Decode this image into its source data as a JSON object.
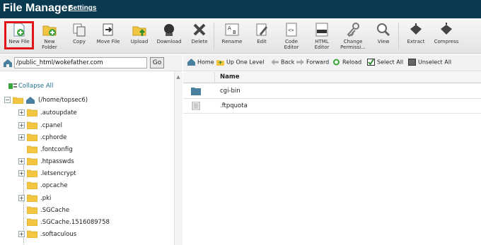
{
  "header": {
    "title": "File Manager",
    "settings_label": "Settings"
  },
  "toolbar": {
    "buttons": [
      {
        "label": "New File",
        "icon": "new-file-icon",
        "highlighted": true
      },
      {
        "label": "New\nFolder",
        "icon": "new-folder-icon"
      },
      {
        "label": "Copy",
        "icon": "copy-icon"
      },
      {
        "label": "Move File",
        "icon": "move-file-icon"
      },
      {
        "label": "Upload",
        "icon": "upload-icon"
      },
      {
        "label": "Download",
        "icon": "download-icon"
      },
      {
        "label": "Delete",
        "icon": "delete-icon"
      },
      {
        "label": "Rename",
        "icon": "rename-icon"
      },
      {
        "label": "Edit",
        "icon": "edit-icon"
      },
      {
        "label": "Code\nEditor",
        "icon": "code-editor-icon"
      },
      {
        "label": "HTML\nEditor",
        "icon": "html-editor-icon"
      },
      {
        "label": "Change\nPermissi...",
        "icon": "permissions-icon"
      },
      {
        "label": "View",
        "icon": "view-icon"
      },
      {
        "label": "Extract",
        "icon": "extract-icon"
      },
      {
        "label": "Compress",
        "icon": "compress-icon"
      }
    ],
    "highlight_color": "#e2141a"
  },
  "path_bar": {
    "path": "/public_html/wokefather.com",
    "go_label": "Go"
  },
  "tree": {
    "collapse_label": "Collapse All",
    "root": "(/home/topsec6)",
    "items": [
      {
        "label": ".autoupdate",
        "expandable": true
      },
      {
        "label": ".cpanel",
        "expandable": true
      },
      {
        "label": ".cphorde",
        "expandable": true
      },
      {
        "label": ".fontconfig",
        "expandable": false
      },
      {
        "label": ".htpasswds",
        "expandable": true
      },
      {
        "label": ".letsencrypt",
        "expandable": true
      },
      {
        "label": ".opcache",
        "expandable": false
      },
      {
        "label": ".pki",
        "expandable": true
      },
      {
        "label": ".SGCache",
        "expandable": false
      },
      {
        "label": ".SGCache.1516089758",
        "expandable": false
      },
      {
        "label": ".softaculous",
        "expandable": true
      }
    ]
  },
  "nav": {
    "home": "Home",
    "up": "Up One Level",
    "back": "Back",
    "forward": "Forward",
    "reload": "Reload",
    "select_all": "Select All",
    "unselect_all": "Unselect All"
  },
  "files": {
    "column_name": "Name",
    "rows": [
      {
        "name": "cgi-bin",
        "type": "folder"
      },
      {
        "name": ".ftpquota",
        "type": "file"
      }
    ]
  },
  "colors": {
    "header_bg": "#093a4f",
    "folder": "#f3c642",
    "link": "#1f6f8b"
  }
}
